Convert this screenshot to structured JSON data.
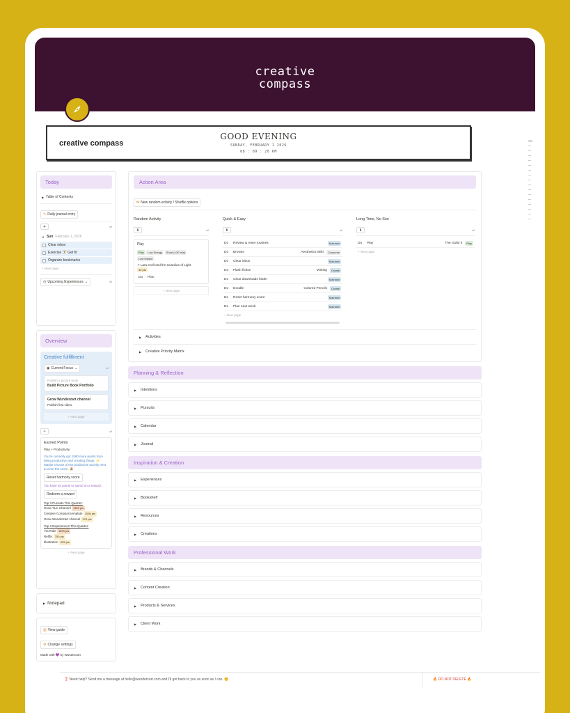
{
  "banner": {
    "title_line1": "creative",
    "title_line2": "compass"
  },
  "page": {
    "title": "creative compass"
  },
  "greeting": {
    "title": "GOOD EVENING",
    "date": "SUNDAY, FEBRUARY 1 2026",
    "time": "08 : 09 : 20 PM"
  },
  "today": {
    "header": "Today",
    "toc": "Table of Contents",
    "journal_button": "Daily journal entry",
    "day_label": "Sun",
    "day_date": "February 1, 2026",
    "tasks": [
      "Clear inbox",
      "Exercise 🏋️ Get fit",
      "Organize bookmarks"
    ],
    "new_page": "New page",
    "upcoming": "Upcoming Experiences"
  },
  "overview": {
    "header": "Overview",
    "fulfillment_title": "Creative fulfillment",
    "current_focus": "Current Focus",
    "card1_sub": "Publish a picture book",
    "card1_title": "Build Picture Book Portfolio",
    "card2_title": "Grow Wunderzart channel",
    "card2_sub": "Publish first video",
    "new_page": "New page",
    "earned_points": "Earned Points",
    "play_productivity": "Play + Productivity",
    "points_msg": "You're currently got 1590 more points from being productive and creating things. ✨ Maybe choose a less productive activity next to even the score. 🎉",
    "reset_button": "Reset harmony score",
    "reward_msg": "You have 45 points to spend on a reward.",
    "redeem_button": "Redeem a reward",
    "top_pursuits_title": "Top 3 Pursuits This Quarter:",
    "top_pursuits": [
      {
        "name": "Grow YLC Channel",
        "pts": "1359 pts"
      },
      {
        "name": "Creative Compass template",
        "pts": "1036 pts"
      },
      {
        "name": "Grow Wunderzart channel",
        "pts": "375 pts"
      }
    ],
    "top_experiences_title": "Top 3 Experiences This Quarter:",
    "top_experiences": [
      {
        "name": "YouTube",
        "pts": "1899 pts"
      },
      {
        "name": "Netflix",
        "pts": "750 pts"
      },
      {
        "name": "Illustration",
        "pts": "325 pts"
      }
    ],
    "new_page2": "New page"
  },
  "notepad": "Notepad",
  "help": {
    "view_guide": "View guide",
    "change_settings": "Change settings",
    "made_with": "Made with 💜 by Wunderzart"
  },
  "action": {
    "header": "Action Area",
    "shuffle_button": "New random activity / Shuffle options",
    "random_title": "Random Activity",
    "quick_title": "Quick & Easy",
    "long_title": "Long Time, No See",
    "random_card": {
      "title": "Play",
      "tags": [
        "Play",
        "Low Energy",
        "Short (<30 min)",
        "Low impact"
      ],
      "link": "Lara Croft and the Guardian of Light",
      "pts": "30 pts"
    },
    "random_do": {
      "do": "Do",
      "name": "Plan"
    },
    "random_new_page": "New page",
    "quick_rows": [
      {
        "do": "Do",
        "name": "Review & reset routines",
        "rel": "",
        "tag": "Maintain"
      },
      {
        "do": "Do",
        "name": "Browse",
        "rel": "Aesthetics Wiki",
        "tag": "Consume"
      },
      {
        "do": "Do",
        "name": "Clear inbox",
        "rel": "",
        "tag": "Maintain"
      },
      {
        "do": "Do",
        "name": "Flash fiction",
        "rel": "Writing",
        "tag": "Create"
      },
      {
        "do": "Do",
        "name": "Clear downloads folder",
        "rel": "",
        "tag": "Maintain"
      },
      {
        "do": "Do",
        "name": "Doodle",
        "rel": "Colored Pencils",
        "tag": "Create"
      },
      {
        "do": "Do",
        "name": "Reset harmony score",
        "rel": "",
        "tag": "Maintain"
      },
      {
        "do": "Do",
        "name": "Plan next week",
        "rel": "",
        "tag": "Maintain"
      }
    ],
    "quick_new_page": "New page",
    "long_row": {
      "do": "Do",
      "name": "Play",
      "rel": "The Guild II",
      "tag": "Play"
    },
    "long_new_page": "New page",
    "toggles": [
      "Activities",
      "Creative Priority Matrix"
    ]
  },
  "sections": [
    {
      "header": "Planning & Reflection",
      "items": [
        "Intentions",
        "Pursuits",
        "Calendar",
        "Journal"
      ]
    },
    {
      "header": "Inspiration & Creation",
      "items": [
        "Experiences",
        "Bookshelf",
        "Resources",
        "Creations"
      ]
    },
    {
      "header": "Professional Work",
      "items": [
        "Brands & Channels",
        "Content Creation",
        "Products & Services",
        "Client Work"
      ]
    }
  ],
  "footer": {
    "message": "Need help? Send me a message at hello@wunderzart.com and I'll get back to you as soon as I can. 😊",
    "do_not_delete": "🔥 DO NOT DELETE 🔥"
  },
  "colors": {
    "background": "#d6b216",
    "banner": "#3d1230",
    "accent_purple": "#9a63c6",
    "pill_purple": "#eee3f7"
  }
}
